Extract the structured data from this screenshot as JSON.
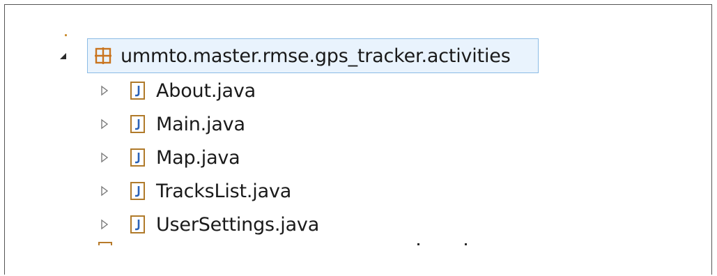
{
  "tree": {
    "package": {
      "label": "ummto.master.rmse.gps_tracker.activities",
      "icon": "package-icon",
      "expanded": true,
      "selected": true
    },
    "files": [
      {
        "label": "About.java",
        "icon": "java-file-icon"
      },
      {
        "label": "Main.java",
        "icon": "java-file-icon"
      },
      {
        "label": "Map.java",
        "icon": "java-file-icon"
      },
      {
        "label": "TracksList.java",
        "icon": "java-file-icon"
      },
      {
        "label": "UserSettings.java",
        "icon": "java-file-icon"
      }
    ]
  },
  "colors": {
    "selection_bg": "#e9f3fd",
    "selection_border": "#8bbbe5",
    "package_icon": "#c9741f",
    "java_icon_border": "#b07a2a",
    "java_icon_letter": "#2a62b8"
  }
}
